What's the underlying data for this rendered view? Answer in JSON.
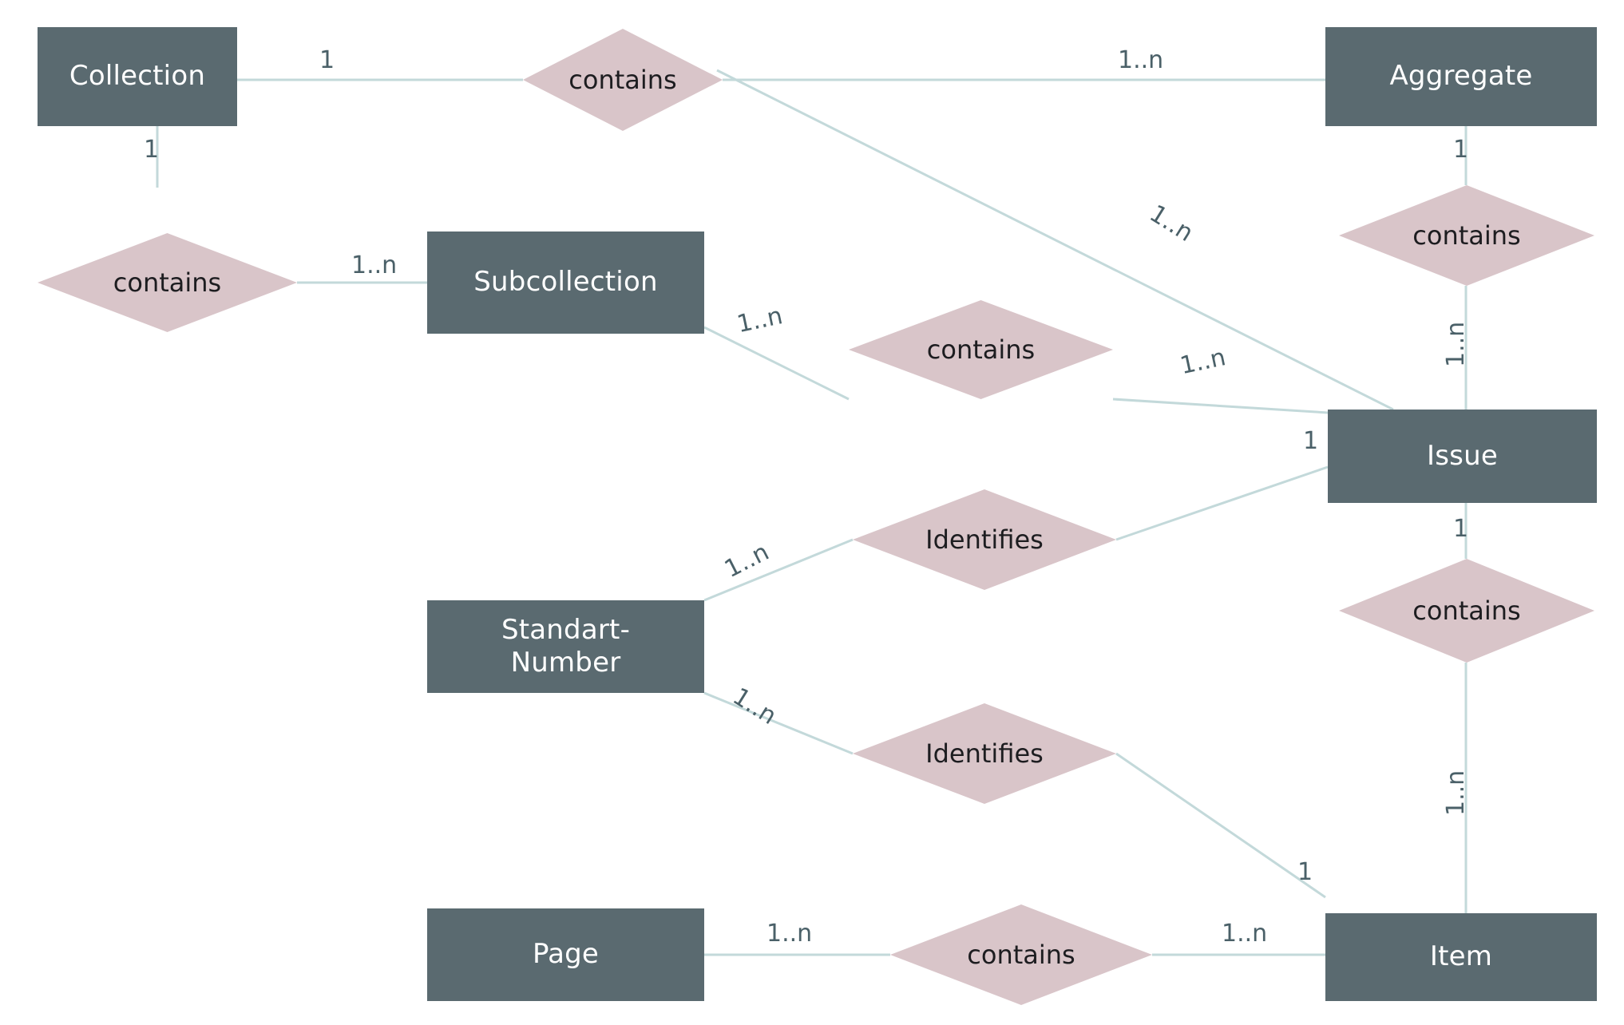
{
  "diagram": {
    "title": "Entity Relationship Diagram",
    "type": "er-diagram",
    "colors": {
      "entity_fill": "#5a6a70",
      "entity_text": "#ffffff",
      "relationship_fill": "#d9c5c9",
      "relationship_text": "#1d1d20",
      "connector_line": "#c3d9da",
      "cardinality_text": "#4a6068",
      "background": "#ffffff"
    }
  },
  "entities": [
    {
      "id": "collection",
      "label": "Collection"
    },
    {
      "id": "aggregate",
      "label": "Aggregate"
    },
    {
      "id": "subcollection",
      "label": "Subcollection"
    },
    {
      "id": "issue",
      "label": "Issue"
    },
    {
      "id": "standart_number",
      "label": "Standart-\nNumber",
      "line1": "Standart-",
      "line2": "Number"
    },
    {
      "id": "page",
      "label": "Page"
    },
    {
      "id": "item",
      "label": "Item"
    }
  ],
  "relationships": [
    {
      "id": "rel_collection_aggregate",
      "label": "contains"
    },
    {
      "id": "rel_aggregate_issue",
      "label": "contains"
    },
    {
      "id": "rel_collection_subcollection",
      "label": "contains"
    },
    {
      "id": "rel_subcollection_issue",
      "label": "contains"
    },
    {
      "id": "rel_issue_item",
      "label": "contains"
    },
    {
      "id": "rel_stdnum_issue",
      "label": "Identifies"
    },
    {
      "id": "rel_stdnum_item",
      "label": "Identifies"
    },
    {
      "id": "rel_page_item",
      "label": "contains"
    }
  ],
  "cardinalities": {
    "collection_to_contains_top": "1",
    "contains_top_to_aggregate": "1..n",
    "collection_to_contains_left": "1",
    "contains_left_to_subcollection": "1..n",
    "aggregate_to_contains_right": "1",
    "contains_right_to_issue": "1..n",
    "contains_top_to_issue": "1..n",
    "subcollection_to_contains_mid": "1..n",
    "contains_mid_to_issue": "1..n",
    "issue_to_identifies": "1",
    "stdnum_to_identifies_upper": "1..n",
    "stdnum_to_identifies_lower": "1..n",
    "identifies_lower_to_item": "1",
    "issue_to_contains_bottom": "1",
    "contains_bottom_to_item": "1..n",
    "page_to_contains_bottom": "1..n",
    "contains_bottom_to_item_right": "1..n"
  }
}
